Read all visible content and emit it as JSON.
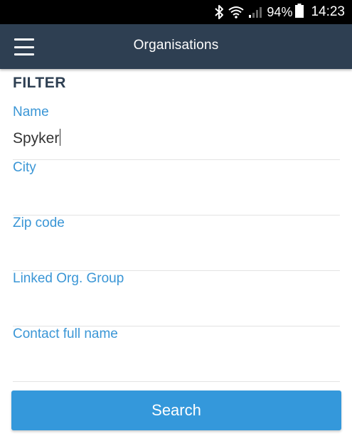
{
  "status_bar": {
    "icons": [
      "bluetooth-icon",
      "wifi-icon",
      "signal-icon",
      "battery-icon"
    ],
    "battery_percent": "94%",
    "time": "14:23"
  },
  "app_bar": {
    "menu_icon": "hamburger-menu-icon",
    "title": "Organisations",
    "background_color": "#2e3f52"
  },
  "filter": {
    "heading": "FILTER",
    "fields": [
      {
        "label": "Name",
        "value": "Spyker"
      },
      {
        "label": "City",
        "value": ""
      },
      {
        "label": "Zip code",
        "value": ""
      },
      {
        "label": "Linked Org. Group",
        "value": ""
      },
      {
        "label": "Contact full name",
        "value": ""
      }
    ],
    "label_color": "#3a96d6"
  },
  "search_button": {
    "label": "Search",
    "color": "#3498db"
  }
}
